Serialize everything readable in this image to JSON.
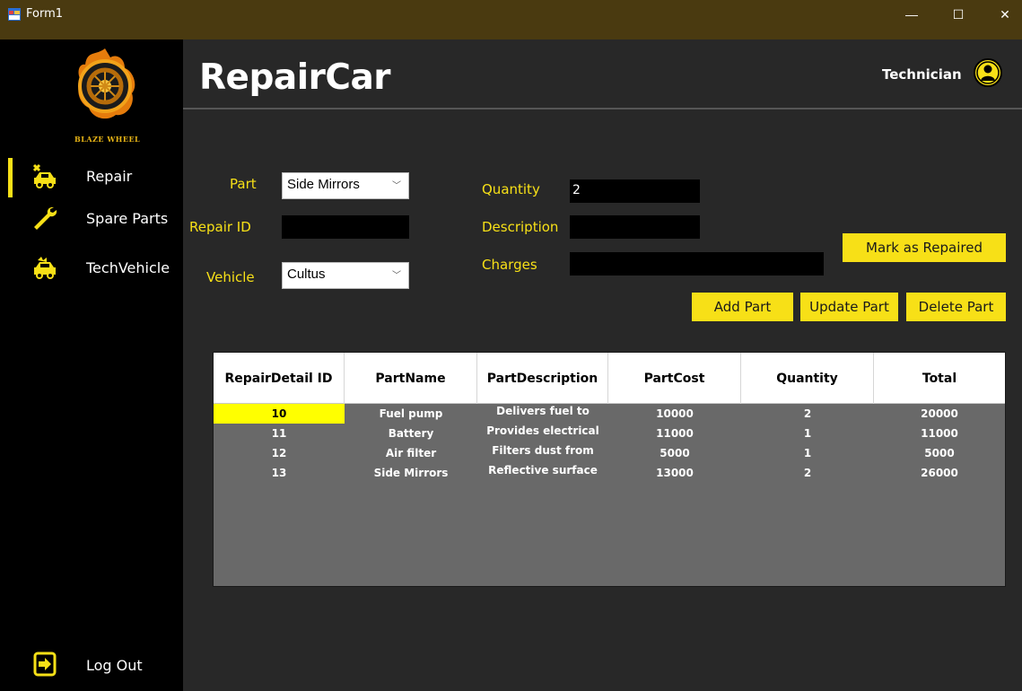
{
  "window": {
    "title": "Form1",
    "minimize_glyph": "—",
    "maximize_glyph": "☐",
    "close_glyph": "✕"
  },
  "sidebar": {
    "logo_text": "BLAZE WHEEL",
    "items": [
      {
        "label": "Repair",
        "icon": "mechanic-car-icon",
        "active": true
      },
      {
        "label": "Spare Parts",
        "icon": "wrench-icon",
        "active": false
      },
      {
        "label": "TechVehicle",
        "icon": "tech-vehicle-icon",
        "active": false
      }
    ],
    "logout_label": "Log Out"
  },
  "header": {
    "title": "RepairCar",
    "user_label": "Technician"
  },
  "form": {
    "part_label": "Part",
    "part_value": "Side Mirrors",
    "repair_id_label": "Repair ID",
    "repair_id_value": "",
    "vehicle_label": "Vehicle",
    "vehicle_value": "Cultus",
    "quantity_label": "Quantity",
    "quantity_value": "2",
    "description_label": "Description",
    "description_value": "",
    "charges_label": "Charges",
    "charges_value": ""
  },
  "buttons": {
    "mark_repaired": "Mark as Repaired",
    "add_part": "Add Part",
    "update_part": "Update Part",
    "delete_part": "Delete Part"
  },
  "grid": {
    "columns": [
      "RepairDetail ID",
      "PartName",
      "PartDescription",
      "PartCost",
      "Quantity",
      "Total"
    ],
    "rows": [
      [
        "10",
        "Fuel pump",
        "Delivers fuel to",
        "10000",
        "2",
        "20000"
      ],
      [
        "11",
        "Battery",
        "Provides electrical",
        "11000",
        "1",
        "11000"
      ],
      [
        "12",
        "Air filter",
        "Filters dust from",
        "5000",
        "1",
        "5000"
      ],
      [
        "13",
        "Side Mirrors",
        "Reflective surface",
        "13000",
        "2",
        "26000"
      ]
    ],
    "selected_cell": "10"
  },
  "colors": {
    "accent": "#f7e017",
    "titlebar": "#4a3a10",
    "main_bg": "#282828",
    "grid_bg": "#696969"
  }
}
